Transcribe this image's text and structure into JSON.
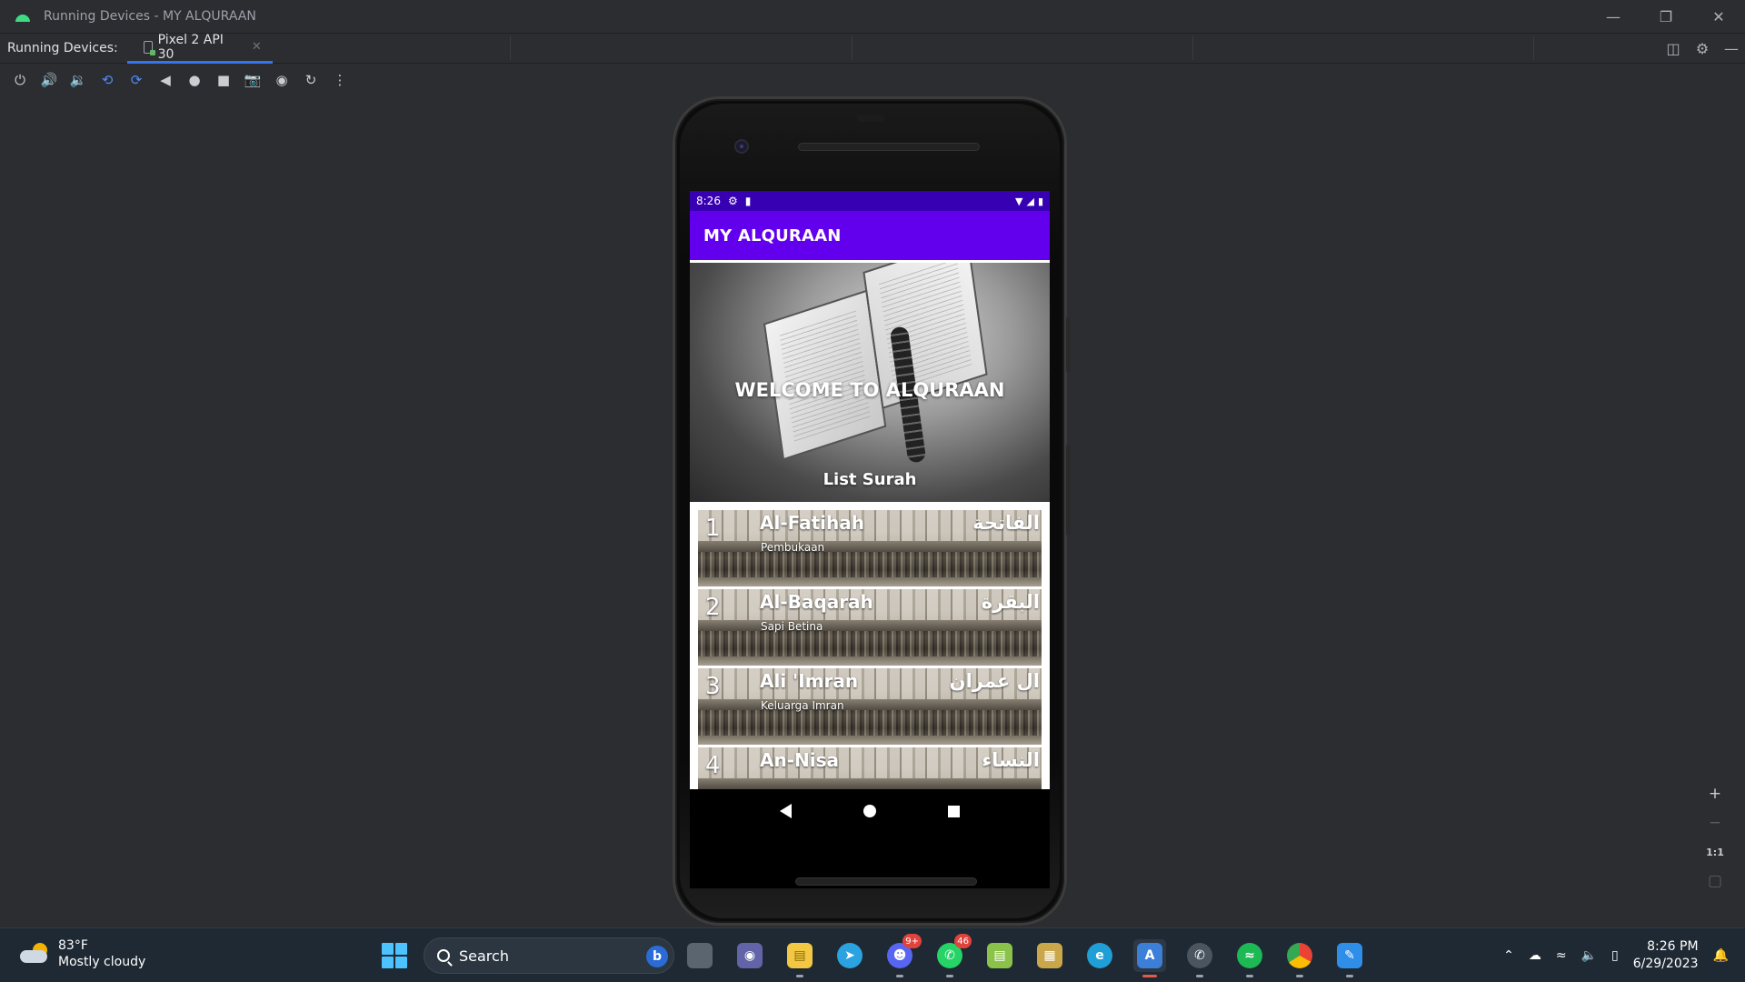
{
  "window": {
    "title": "Running Devices - MY ALQURAAN",
    "controls": [
      "minimize-icon",
      "restore-icon",
      "close-icon"
    ]
  },
  "tabbar": {
    "label": "Running Devices:",
    "tab_label": "Pixel 2 API 30"
  },
  "toolbar": {
    "icons": [
      "power-icon",
      "volume-up-icon",
      "volume-down-icon",
      "rotate-left-icon",
      "rotate-right-icon",
      "back-icon",
      "home-icon",
      "overview-icon",
      "screenshot-icon",
      "screen-record-icon",
      "reset-icon",
      "more-icon"
    ]
  },
  "device": {
    "status_time": "8:26",
    "app_title": "MY ALQURAAN",
    "hero_title": "WELCOME TO ALQURAAN",
    "list_title": "List Surah",
    "surahs": [
      {
        "number": "1",
        "name": "Al-Fatihah",
        "meaning": "Pembukaan",
        "arabic": "الفاتحة"
      },
      {
        "number": "2",
        "name": "Al-Baqarah",
        "meaning": "Sapi Betina",
        "arabic": "البقرة"
      },
      {
        "number": "3",
        "name": "Ali 'Imran",
        "meaning": "Keluarga Imran",
        "arabic": "ال عمران"
      },
      {
        "number": "4",
        "name": "An-Nisa",
        "meaning": "",
        "arabic": "النساء"
      }
    ]
  },
  "zoom": {
    "plus": "+",
    "minus": "−",
    "one_to_one": "1:1"
  },
  "taskbar": {
    "weather_temp": "83°F",
    "weather_desc": "Mostly cloudy",
    "search_label": "Search",
    "discord_badge": "9+",
    "whatsapp_badge": "46",
    "time": "8:26 PM",
    "date": "6/29/2023"
  },
  "colors": {
    "status_bar": "#3700b3",
    "app_bar": "#6200ee",
    "ide_background": "#2b2d30",
    "tab_accent": "#3574f0"
  }
}
